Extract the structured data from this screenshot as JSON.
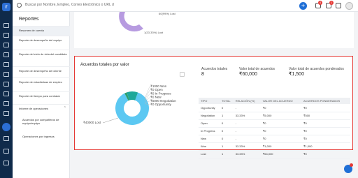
{
  "topbar": {
    "search_placeholder": "Buscar por Nombre, Empleo, Correo Electrónico o URL d",
    "plus_label": "+",
    "notifications_count": "4",
    "chat_count": "1"
  },
  "sidebar": {
    "title": "Reportes",
    "items": [
      {
        "label": "Resumen de cuenta"
      },
      {
        "label": "Reporte de desempeño del equipo"
      },
      {
        "label": "Reporte del ciclo de vida del candidato"
      },
      {
        "label": "Reporte de desempeño del cliente"
      },
      {
        "label": "Reporte de estadísticas de empleo"
      },
      {
        "label": "Reporte de tiempo para contratar"
      },
      {
        "label": "Informe de operaciones"
      }
    ],
    "subitems": [
      {
        "label": "Acuerdos por compañeros de equipo/equipo"
      },
      {
        "label": "Operaciones por ingresos"
      }
    ]
  },
  "upper": {
    "lost_label": "60(99%) Lost",
    "lost2_label": "1(33.33%) Lost"
  },
  "card": {
    "title": "Acuerdos totales por valor",
    "stats": [
      {
        "label": "Acuerdos totales",
        "value": "8"
      },
      {
        "label": "Valor total de acuerdos",
        "value": "₹60,000"
      },
      {
        "label": "Valor total de acuerdos ponderados",
        "value": "₹1,500"
      }
    ]
  },
  "chart_data": {
    "type": "pie",
    "title": "",
    "slices": [
      {
        "label": "₹40000 Lost",
        "value": 40000,
        "color": "#5cc8f2"
      },
      {
        "label": "₹1000 Won",
        "value": 1000,
        "color": "#2e9e6b"
      },
      {
        "label": "₹0 Open",
        "value": 0,
        "color": "#7e5cc2"
      },
      {
        "label": "₹0 In Progress",
        "value": 0,
        "color": "#e0b84a"
      },
      {
        "label": "₹0 New",
        "value": 0,
        "color": "#e36a6a"
      },
      {
        "label": "₹5000 Negotiation",
        "value": 5000,
        "color": "#1ea89a"
      },
      {
        "label": "₹0 Opportunity",
        "value": 0,
        "color": "#9ad0e8"
      }
    ]
  },
  "table": {
    "headers": [
      "TIPO",
      "TOTAL",
      "RELACIÓN (%)",
      "VALOR DEL ACUERDO",
      "ACUERDOS PONDERADOS"
    ],
    "rows": [
      [
        "Opportunity",
        "0",
        "-",
        "₹0",
        "₹0"
      ],
      [
        "Negotiation",
        "1",
        "33.33%",
        "₹5,000",
        "₹500"
      ],
      [
        "Open",
        "0",
        "-",
        "₹0",
        "₹0"
      ],
      [
        "In Progress",
        "0",
        "-",
        "₹0",
        "₹0"
      ],
      [
        "New",
        "0",
        "-",
        "₹0",
        "₹0"
      ],
      [
        "Won",
        "1",
        "33.33%",
        "₹1,000",
        "₹1,000"
      ],
      [
        "Lost",
        "1",
        "33.33%",
        "₹54,000",
        "₹0"
      ]
    ]
  }
}
